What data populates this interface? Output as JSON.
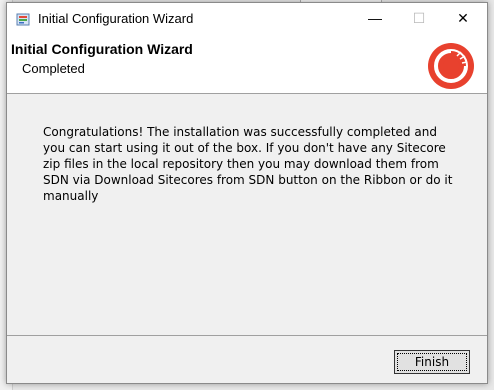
{
  "window": {
    "title": "Initial Configuration Wizard",
    "controls": {
      "minimize": "—",
      "maximize": "☐",
      "close": "✕"
    }
  },
  "header": {
    "title": "Initial Configuration Wizard",
    "subtitle": "Completed",
    "logo_icon": "sitecore-logo",
    "logo_color": "#e8412e"
  },
  "message": "Congratulations! The installation was successfully completed and you can start using it out of the box. If you don't have any Sitecore zip files in the local repository then you may download them from SDN via Download Sitecores from SDN button on the Ribbon or do it manually",
  "footer": {
    "finish_label": "Finish"
  }
}
